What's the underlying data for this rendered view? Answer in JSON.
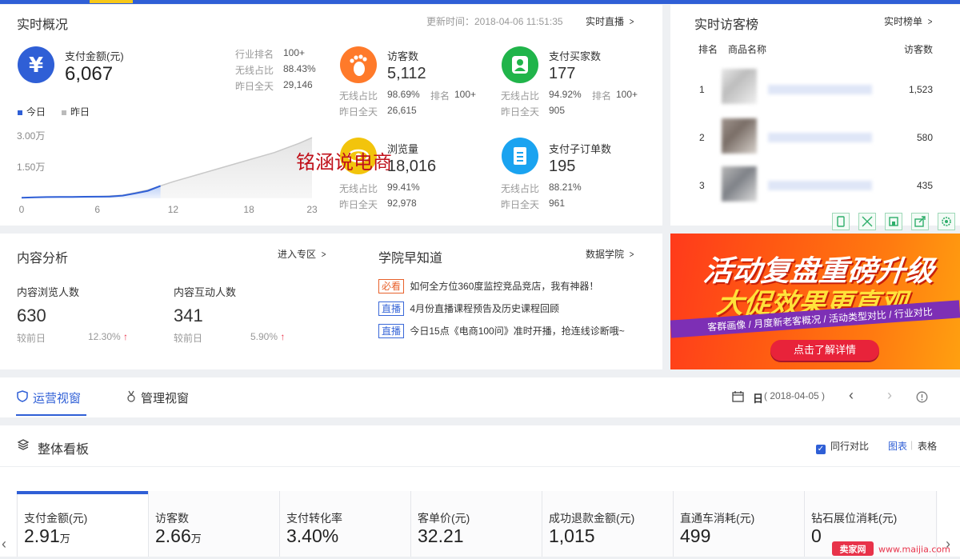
{
  "realtime": {
    "title": "实时概况",
    "update_time": "更新时间：2018-04-06 11:51:35",
    "live_link": "实时直播",
    "payment": {
      "label": "支付金额(元)",
      "value": "6,067",
      "industry_rank_label": "行业排名",
      "industry_rank_value": "100+",
      "wireless_label": "无线占比",
      "wireless_value": "88.43%",
      "yesterday_label": "昨日全天",
      "yesterday_value": "29,146"
    },
    "legend_today": "今日",
    "legend_yesterday": "昨日",
    "visitors": {
      "label": "访客数",
      "value": "5,112",
      "wireless_label": "无线占比",
      "wireless_value": "98.69%",
      "rank_label": "排名",
      "rank_value": "100+",
      "yesterday_label": "昨日全天",
      "yesterday_value": "26,615"
    },
    "buyers": {
      "label": "支付买家数",
      "value": "177",
      "wireless_label": "无线占比",
      "wireless_value": "94.92%",
      "rank_label": "排名",
      "rank_value": "100+",
      "yesterday_label": "昨日全天",
      "yesterday_value": "905"
    },
    "pageviews": {
      "label": "浏览量",
      "value": "18,016",
      "wireless_label": "无线占比",
      "wireless_value": "99.41%",
      "yesterday_label": "昨日全天",
      "yesterday_value": "92,978"
    },
    "suborders": {
      "label": "支付子订单数",
      "value": "195",
      "wireless_label": "无线占比",
      "wireless_value": "88.21%",
      "yesterday_label": "昨日全天",
      "yesterday_value": "961"
    }
  },
  "chart_data": {
    "type": "area",
    "yticks": [
      "3.00万",
      "1.50万"
    ],
    "xticks": [
      "0",
      "6",
      "12",
      "18",
      "23"
    ],
    "ylim": [
      0,
      30000
    ],
    "xlim": [
      0,
      23
    ],
    "series": [
      {
        "name": "今日",
        "x": [
          0,
          1,
          2,
          3,
          4,
          5,
          6,
          7,
          8,
          9,
          10,
          11
        ],
        "values": [
          300,
          500,
          600,
          650,
          700,
          750,
          800,
          900,
          1300,
          2400,
          3600,
          6000
        ]
      },
      {
        "name": "昨日",
        "x": [
          0,
          2,
          4,
          6,
          8,
          10,
          12,
          14,
          16,
          18,
          20,
          22,
          23
        ],
        "values": [
          300,
          600,
          700,
          800,
          1500,
          4000,
          8000,
          11500,
          15000,
          18500,
          22000,
          26500,
          29146
        ]
      }
    ]
  },
  "watermark": "铭涵说电商",
  "visitor_rank": {
    "title": "实时访客榜",
    "link": "实时榜单",
    "col_rank": "排名",
    "col_name": "商品名称",
    "col_visitors": "访客数",
    "rows": [
      {
        "rank": "1",
        "visitors": "1,523"
      },
      {
        "rank": "2",
        "visitors": "580"
      },
      {
        "rank": "3",
        "visitors": "435"
      }
    ],
    "tools": [
      "phone-icon",
      "expand-icon",
      "save-icon",
      "share-icon",
      "settings-icon"
    ]
  },
  "content": {
    "title": "内容分析",
    "link": "进入专区",
    "browse_label": "内容浏览人数",
    "browse_value": "630",
    "browse_cmp_label": "较前日",
    "browse_cmp_value": "12.30%",
    "interact_label": "内容互动人数",
    "interact_value": "341",
    "interact_cmp_label": "较前日",
    "interact_cmp_value": "5.90%"
  },
  "academy": {
    "title": "学院早知道",
    "link": "数据学院",
    "items": [
      {
        "tag": "必看",
        "text": "如何全方位360度监控竞品竞店，我有神器！"
      },
      {
        "tag": "直播",
        "text": "4月份直播课程预告及历史课程回顾"
      },
      {
        "tag": "直播",
        "text": "今日15点《电商100问》准时开播，抢连线诊断哦~"
      }
    ]
  },
  "banner": {
    "line1": "活动复盘重磅升级",
    "line2": "大促效果更直观",
    "strip": "客群画像 / 月度新老客概况 / 活动类型对比 / 行业对比",
    "button": "点击了解详情"
  },
  "tabs": {
    "ops": "运营视窗",
    "mgmt": "管理视窗",
    "day_label": "日",
    "date": "( 2018-04-05 )"
  },
  "dashboard": {
    "title": "整体看板",
    "peer_compare": "同行对比",
    "view_chart": "图表",
    "view_table": "表格",
    "metrics": [
      {
        "label": "支付金额(元)",
        "value": "2.91",
        "unit": "万"
      },
      {
        "label": "访客数",
        "value": "2.66",
        "unit": "万"
      },
      {
        "label": "支付转化率",
        "value": "3.40%",
        "unit": ""
      },
      {
        "label": "客单价(元)",
        "value": "32.21",
        "unit": ""
      },
      {
        "label": "成功退款金额(元)",
        "value": "1,015",
        "unit": ""
      },
      {
        "label": "直通车消耗(元)",
        "value": "499",
        "unit": ""
      },
      {
        "label": "钻石展位消耗(元)",
        "value": "0",
        "unit": ""
      }
    ]
  },
  "footer_logo": "卖家网 www.maijia.com",
  "colors": {
    "accent": "#2f5fd6",
    "orange": "#ff7a2a",
    "green": "#20b44a",
    "yellow": "#f2c40c",
    "cyan": "#1aa3f0"
  }
}
